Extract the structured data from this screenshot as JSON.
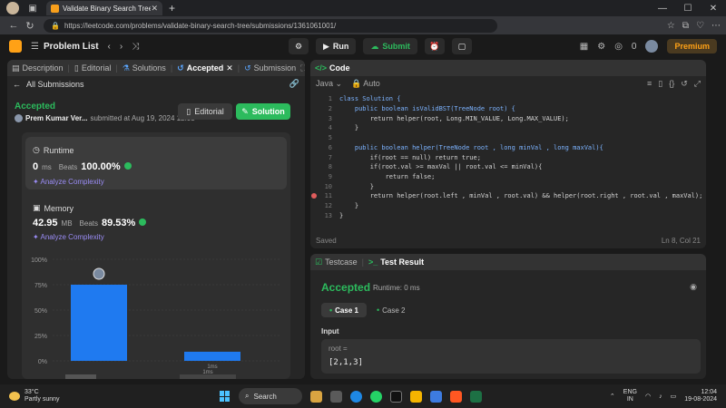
{
  "browser": {
    "tab_title": "Validate Binary Search Tree - Lee",
    "url": "https://leetcode.com/problems/validate-binary-search-tree/submissions/1361061001/"
  },
  "nav": {
    "problem_list": "Problem List",
    "run": "Run",
    "submit": "Submit",
    "streak": "0",
    "premium": "Premium"
  },
  "left": {
    "tabs": [
      {
        "label": "Description"
      },
      {
        "label": "Editorial"
      },
      {
        "label": "Solutions"
      },
      {
        "label": "Accepted"
      },
      {
        "label": "Submission"
      }
    ],
    "all_submissions": "All Submissions",
    "status": "Accepted",
    "author": "Prem Kumar Ver...",
    "submitted_at": "submitted at Aug 19, 2024 12:03",
    "editorial_btn": "Editorial",
    "solution_btn": "Solution",
    "runtime": {
      "title": "Runtime",
      "value": "0",
      "unit": "ms",
      "beats_label": "Beats",
      "beats_value": "100.00%",
      "analyze": "Analyze Complexity"
    },
    "memory": {
      "title": "Memory",
      "value": "42.95",
      "unit": "MB",
      "beats_label": "Beats",
      "beats_value": "89.53%",
      "analyze": "Analyze Complexity"
    }
  },
  "chart_data": {
    "type": "bar",
    "categories": [
      "",
      "1ms"
    ],
    "values": [
      75,
      9
    ],
    "yticks": [
      "100%",
      "75%",
      "50%",
      "25%",
      "0%"
    ],
    "ylim": [
      0,
      100
    ],
    "secondary_label": "1ms",
    "colors": {
      "bar": "#1f7af0",
      "secondary": "#555555"
    }
  },
  "code": {
    "language": "Java",
    "mode": "Auto",
    "title": "Code",
    "lines": [
      "class Solution {",
      "    public boolean isValidBST(TreeNode root) {",
      "        return helper(root, Long.MIN_VALUE, Long.MAX_VALUE);",
      "    }",
      "",
      "    public boolean helper(TreeNode root , long minVal , long maxVal){",
      "        if(root == null) return true;",
      "        if(root.val >= maxVal || root.val <= minVal){",
      "            return false;",
      "        }",
      "        return helper(root.left , minVal , root.val) && helper(root.right , root.val , maxVal);",
      "    }",
      "}"
    ],
    "line_numbers": [
      "1",
      "2",
      "3",
      "4",
      "5",
      "6",
      "7",
      "8",
      "9",
      "10",
      "11",
      "12",
      "13"
    ],
    "saved": "Saved",
    "cursor": "Ln 8, Col 21"
  },
  "result": {
    "tab_testcase": "Testcase",
    "tab_result": "Test Result",
    "status": "Accepted",
    "runtime": "Runtime: 0 ms",
    "case1": "Case 1",
    "case2": "Case 2",
    "input_label": "Input",
    "var_name": "root =",
    "var_value": "[2,1,3]"
  },
  "taskbar": {
    "temp": "33°C",
    "weather": "Partly sunny",
    "search": "Search",
    "lang1": "ENG",
    "lang2": "IN",
    "time": "12:04",
    "date": "19-08-2024"
  }
}
